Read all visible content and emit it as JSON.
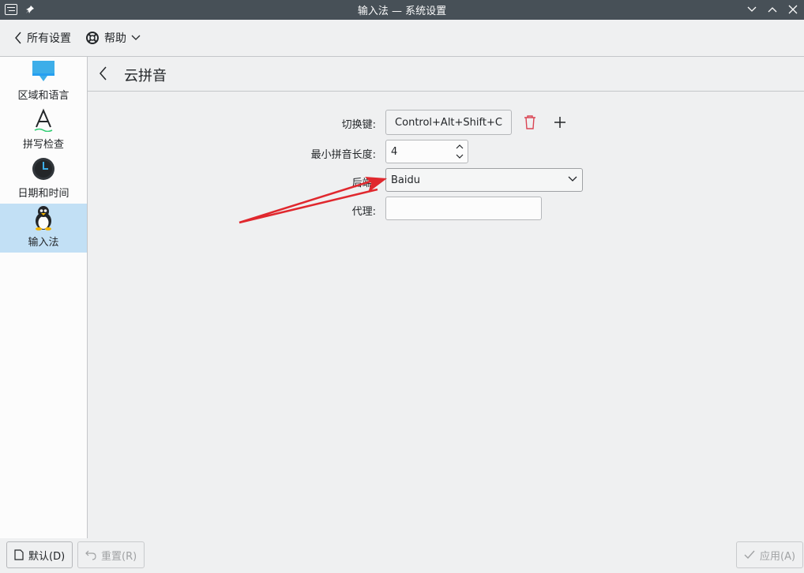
{
  "window": {
    "title": "输入法 — 系统设置"
  },
  "toolbar": {
    "all_settings": "所有设置",
    "help": "帮助"
  },
  "sidebar": {
    "items": [
      {
        "label": "区域和语言",
        "icon": "speech-bubble-icon"
      },
      {
        "label": "拼写检查",
        "icon": "spellcheck-icon"
      },
      {
        "label": "日期和时间",
        "icon": "clock-icon"
      },
      {
        "label": "输入法",
        "icon": "penguin-icon",
        "selected": true
      }
    ]
  },
  "page": {
    "title": "云拼音"
  },
  "form": {
    "toggle_key_label": "切换键:",
    "toggle_key_value": "Control+Alt+Shift+C",
    "min_length_label": "最小拼音长度:",
    "min_length_value": "4",
    "backend_label": "后端:",
    "backend_value": "Baidu",
    "proxy_label": "代理:",
    "proxy_value": ""
  },
  "footer": {
    "defaults": "默认(D)",
    "reset": "重置(R)",
    "apply": "应用(A)"
  },
  "colors": {
    "accent": "#3daee9",
    "selection": "#c2e0f5",
    "annotation": "#e0282e",
    "delete": "#da4453"
  }
}
